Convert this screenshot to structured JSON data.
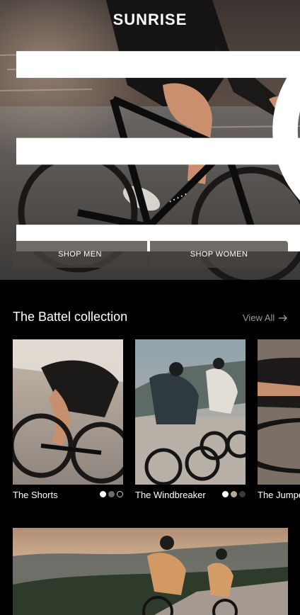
{
  "header": {
    "brand": "SUNRISE",
    "icons": [
      "hamburger-menu-icon",
      "search-icon",
      "shopping-bag-icon"
    ]
  },
  "hero": {
    "shop_men_label": "SHOP MEN",
    "shop_women_label": "SHOP WOMEN"
  },
  "collection": {
    "title": "The Battel collection",
    "view_all_label": "View All",
    "products": [
      {
        "name": "The Shorts",
        "swatches": [
          "#ffffff",
          "#6b6b6b",
          "#000000"
        ]
      },
      {
        "name": "The Windbreaker",
        "swatches": [
          "#ffffff",
          "#b9a89a",
          "#3a3a3a"
        ]
      },
      {
        "name": "The Jumpe"
      }
    ]
  },
  "colors": {
    "background": "#000000",
    "text": "#ffffff",
    "muted": "#9a9a9a",
    "button_bg": "#46423e"
  }
}
